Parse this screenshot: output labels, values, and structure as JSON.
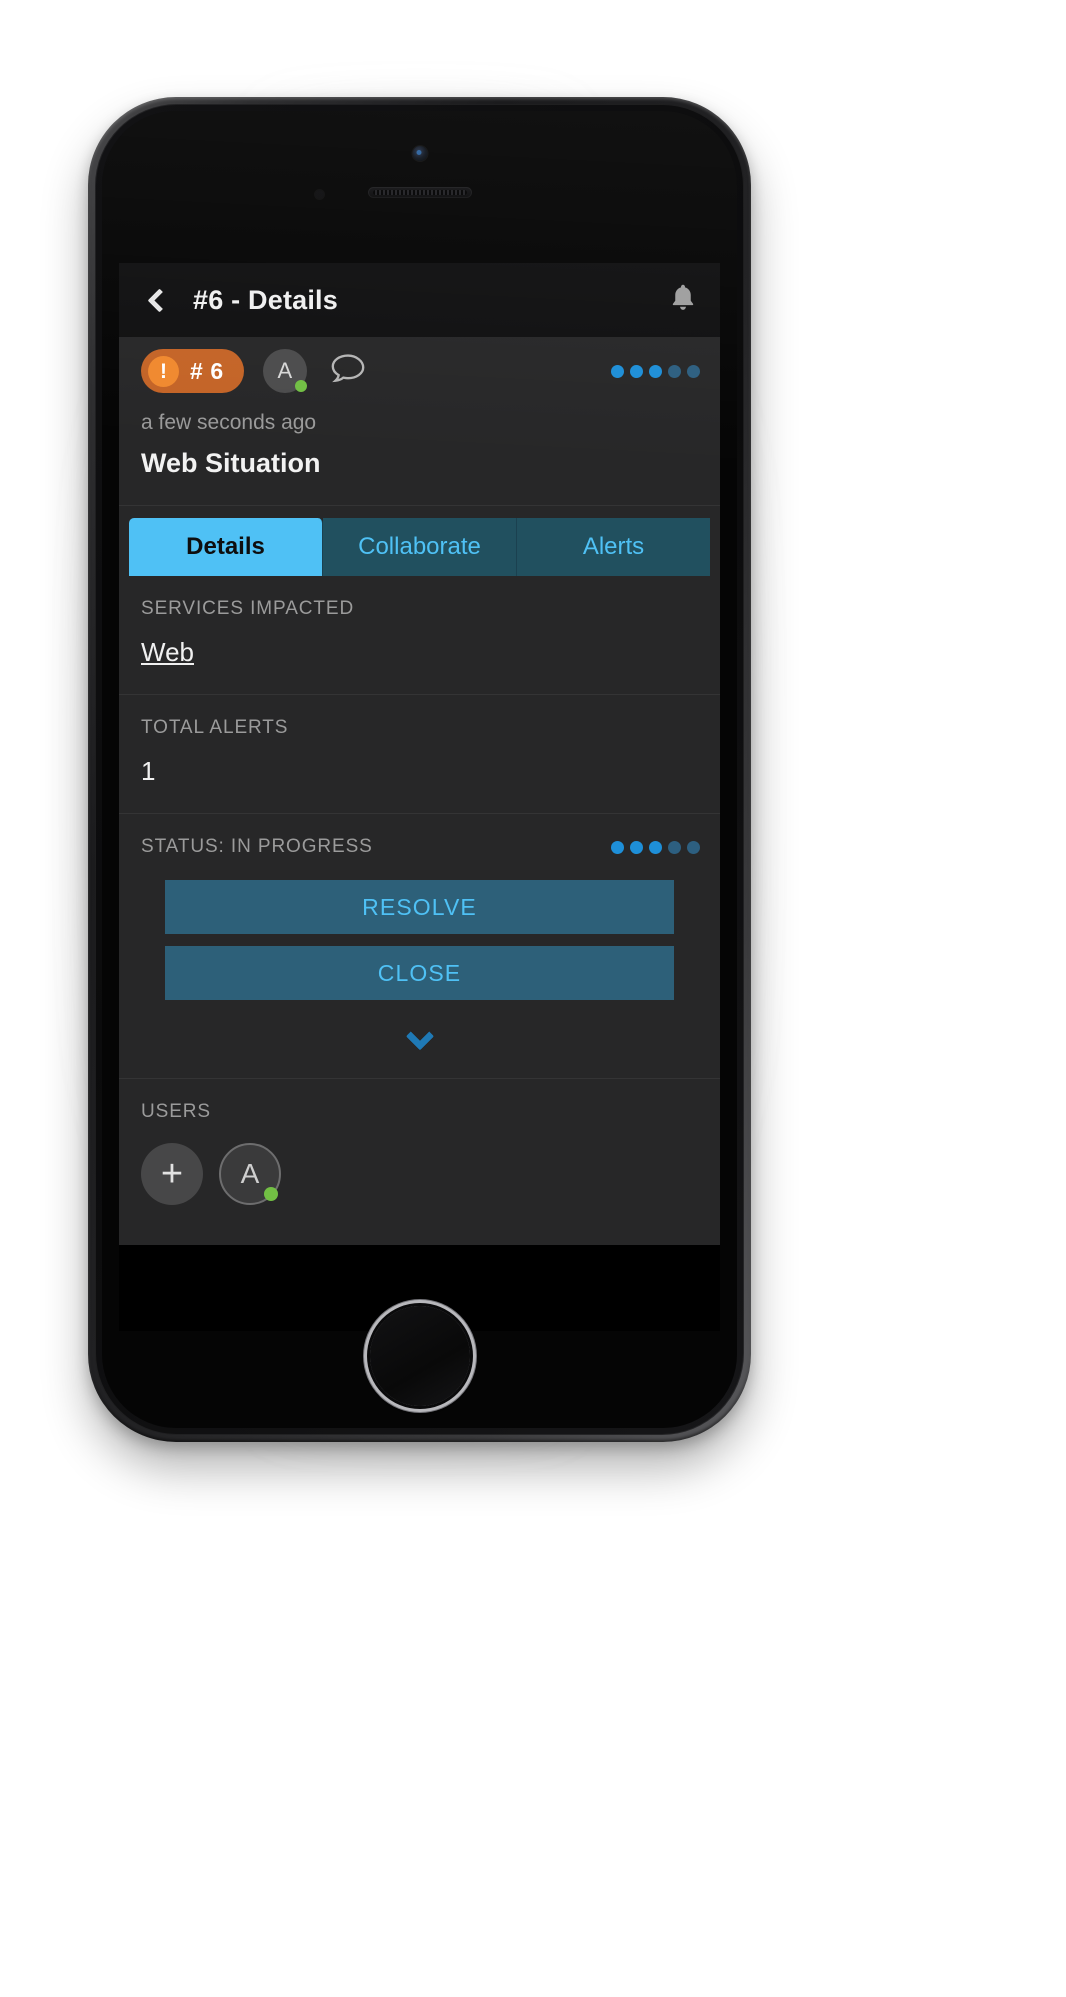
{
  "app": {
    "nav": {
      "back_icon": "chevron-left-icon",
      "title": "#6 - Details",
      "bell_icon": "bell-icon"
    },
    "badge_row": {
      "severity_icon": "exclamation-circle-icon",
      "id_label": "# 6",
      "avatar_initial": "A",
      "avatar_status": "online",
      "chat_icon": "chat-bubble-icon",
      "progress_dots": {
        "total": 5,
        "filled": 3,
        "color": "#1e8fd8",
        "dim_color": "#2d5f80"
      }
    },
    "meta": {
      "timestamp": "a few seconds ago",
      "title": "Web Situation"
    },
    "tabs": [
      {
        "label": "Details",
        "active": true
      },
      {
        "label": "Collaborate",
        "active": false
      },
      {
        "label": "Alerts",
        "active": false
      }
    ],
    "sections": {
      "services_impacted": {
        "label": "SERVICES IMPACTED",
        "value": "Web"
      },
      "total_alerts": {
        "label": "TOTAL ALERTS",
        "value": "1"
      },
      "status": {
        "label": "STATUS: IN PROGRESS",
        "progress_dots": {
          "total": 5,
          "filled": 3
        },
        "buttons": [
          {
            "label": "RESOLVE"
          },
          {
            "label": "CLOSE"
          }
        ],
        "expand_icon": "chevron-down-icon"
      },
      "users": {
        "label": "USERS",
        "add_label": "+",
        "members": [
          {
            "initial": "A",
            "status": "online"
          }
        ]
      }
    },
    "colors": {
      "accent_blue": "#4fc1f5",
      "tab_inactive_bg": "#21505f",
      "button_bg": "#2d6079",
      "severity_orange": "#c46427",
      "severity_icon_orange": "#f0892f",
      "online_green": "#72bf44",
      "screen_bg": "#272728",
      "navbar_bg": "#101011"
    }
  }
}
